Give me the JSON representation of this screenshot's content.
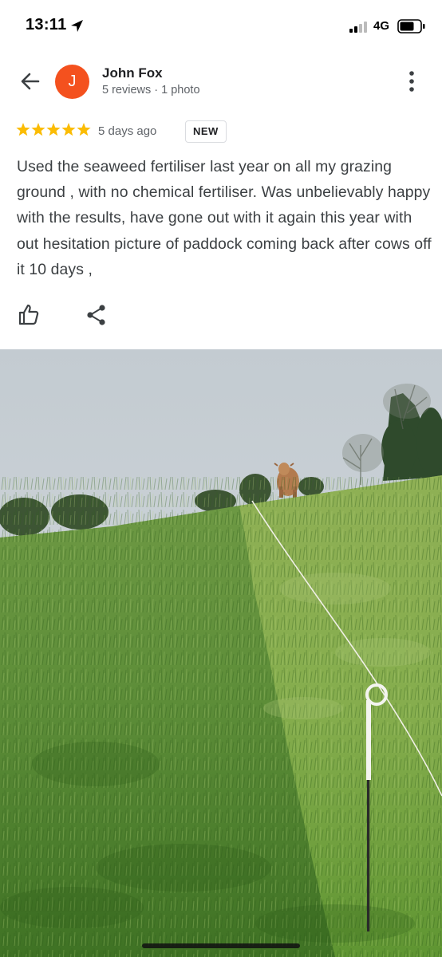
{
  "status_bar": {
    "time": "13:11",
    "location_icon": "location-arrow-icon",
    "signal_icon": "signal-bars-icon",
    "network": "4G",
    "battery_icon": "battery-icon"
  },
  "header": {
    "back_icon": "arrow-left-icon",
    "avatar_letter": "J",
    "avatar_color": "#f4511e",
    "name": "John Fox",
    "meta": "5 reviews · 1 photo",
    "more_icon": "more-vertical-icon"
  },
  "review": {
    "rating": 5,
    "rating_max": 5,
    "star_color": "#fbbc04",
    "time_ago": "5 days ago",
    "badge": "NEW",
    "text": "Used the seaweed fertiliser last year on all my grazing ground , with no chemical fertiliser. Was unbelievably happy with the results, have gone out with it again this year with out hesitation picture of paddock coming back after cows off it 10 days ,"
  },
  "actions": {
    "like_icon": "thumbs-up-icon",
    "share_icon": "share-icon"
  },
  "photo": {
    "subject": "review-photo",
    "colors": {
      "sky": "#c9cfd4",
      "grass_light": "#8db353",
      "grass_dark": "#4f7f2c",
      "trees": "#3b5232",
      "cow": "#b27a4e"
    }
  }
}
